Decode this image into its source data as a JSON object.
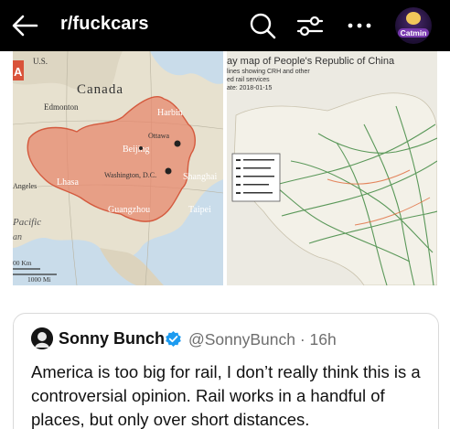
{
  "app_bar": {
    "subreddit": "r/fuckcars",
    "avatar_badge": "Catmin",
    "icons": [
      "back-arrow-icon",
      "search-icon",
      "filter-icon",
      "more-icon"
    ]
  },
  "post_image": {
    "left_map": {
      "country_labels": [
        "U.S.",
        "Canada"
      ],
      "cities": [
        "Edmonton",
        "Harbin",
        "Ottawa",
        "Beijing",
        "Washington, D.C.",
        "Shanghai",
        "Lhasa",
        "Angeles",
        "Guangzhou",
        "Taipei"
      ],
      "ocean_label": "Pacific",
      "ocean_label_2": "an",
      "scale_km": "00 Km",
      "scale_mi": "1000 Mi",
      "corner_badge": "A"
    },
    "right_map": {
      "title": "ay map of People's Republic of China",
      "subtitle_1": "lines showing CRH and other",
      "subtitle_2": "ed rail services",
      "subtitle_3": "ate: 2018-01-15"
    }
  },
  "quoted_tweet": {
    "author_name": "Sonny Bunch",
    "handle_time": "@SonnyBunch · 16h",
    "text": "America is too big for rail, I don’t really think this is a controversial opinion. Rail works in a handful of places, but only over short distances."
  },
  "colors": {
    "topbar_bg": "#000000",
    "verified_blue": "#1d9bf0",
    "china_overlay": "#e8856a",
    "map_water": "#c9dcea",
    "rail_green": "#4a8f4a"
  }
}
